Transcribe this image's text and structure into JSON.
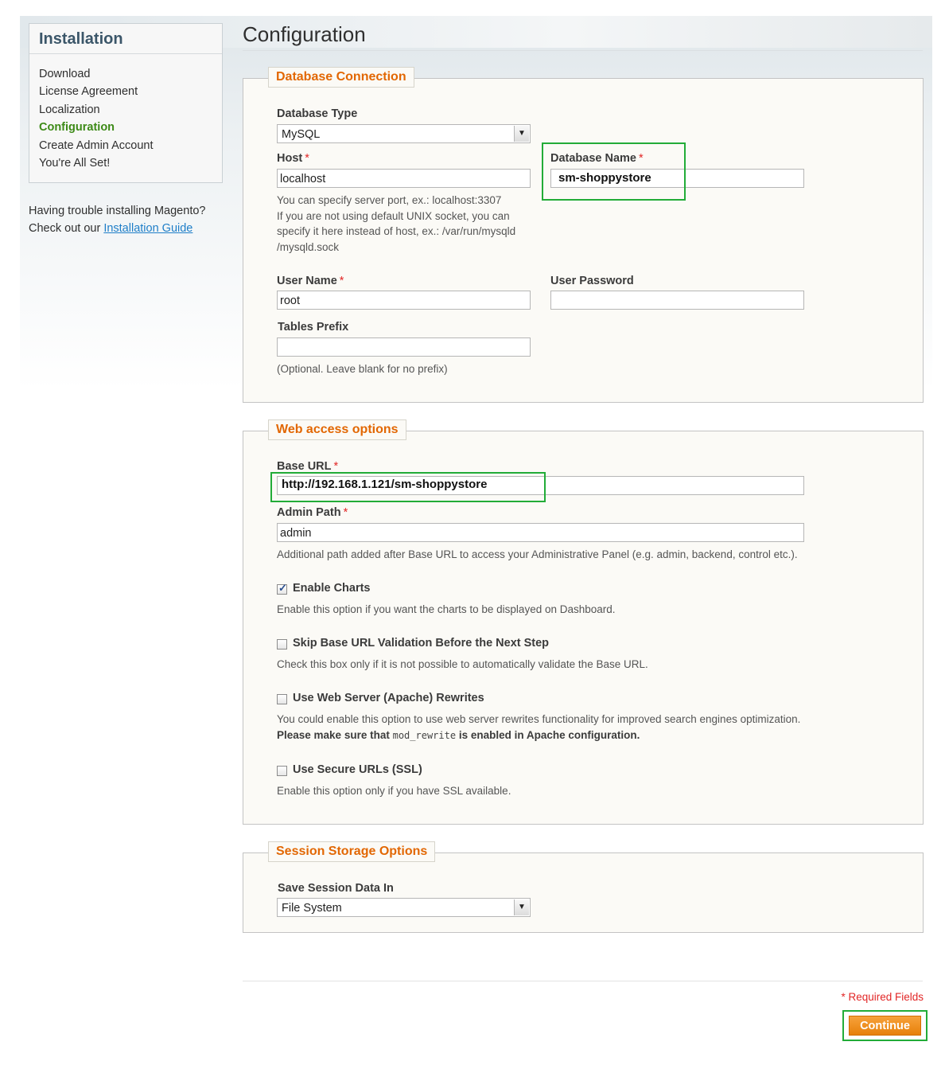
{
  "sidebar": {
    "title": "Installation",
    "steps": [
      {
        "label": "Download"
      },
      {
        "label": "License Agreement"
      },
      {
        "label": "Localization"
      },
      {
        "label": "Configuration",
        "active": true
      },
      {
        "label": "Create Admin Account"
      },
      {
        "label": "You're All Set!"
      }
    ],
    "help_line1": "Having trouble installing Magento?",
    "help_prefix": "Check out our ",
    "help_link": "Installation Guide"
  },
  "page": {
    "title": "Configuration"
  },
  "database": {
    "legend": "Database Connection",
    "type_label": "Database Type",
    "type_value": "MySQL",
    "host_label": "Host",
    "host_value": "localhost",
    "host_note1": "You can specify server port, ex.: localhost:3307",
    "host_note2": "If you are not using default UNIX socket, you can",
    "host_note3": "specify it here instead of host, ex.: /var/run/mysqld",
    "host_note4": "/mysqld.sock",
    "name_label": "Database Name",
    "name_value": "sm-shoppystore",
    "user_label": "User Name",
    "user_value": "root",
    "password_label": "User Password",
    "password_value": "",
    "prefix_label": "Tables Prefix",
    "prefix_value": "",
    "prefix_note": "(Optional. Leave blank for no prefix)"
  },
  "web": {
    "legend": "Web access options",
    "base_url_label": "Base URL",
    "base_url_value": "http://192.168.1.121/sm-shoppystore",
    "admin_path_label": "Admin Path",
    "admin_path_value": "admin",
    "admin_path_note": "Additional path added after Base URL to access your Administrative Panel (e.g. admin, backend, control etc.).",
    "charts": {
      "label": "Enable Charts",
      "checked": true,
      "note": "Enable this option if you want the charts to be displayed on Dashboard."
    },
    "skip_validation": {
      "label": "Skip Base URL Validation Before the Next Step",
      "checked": false,
      "note": "Check this box only if it is not possible to automatically validate the Base URL."
    },
    "rewrites": {
      "label": "Use Web Server (Apache) Rewrites",
      "checked": false,
      "note": "You could enable this option to use web server rewrites functionality for improved search engines optimization.",
      "note2_before": "Please make sure that ",
      "note2_code": "mod_rewrite",
      "note2_after": " is enabled in Apache configuration."
    },
    "ssl": {
      "label": "Use Secure URLs (SSL)",
      "checked": false,
      "note": "Enable this option only if you have SSL available."
    }
  },
  "session": {
    "legend": "Session Storage Options",
    "label": "Save Session Data In",
    "value": "File System"
  },
  "footer": {
    "required": "* Required Fields",
    "continue": "Continue"
  },
  "colors": {
    "accent": "#e26703",
    "active_step": "#3d8a17",
    "highlight": "#22ac38",
    "required": "#e22626"
  }
}
